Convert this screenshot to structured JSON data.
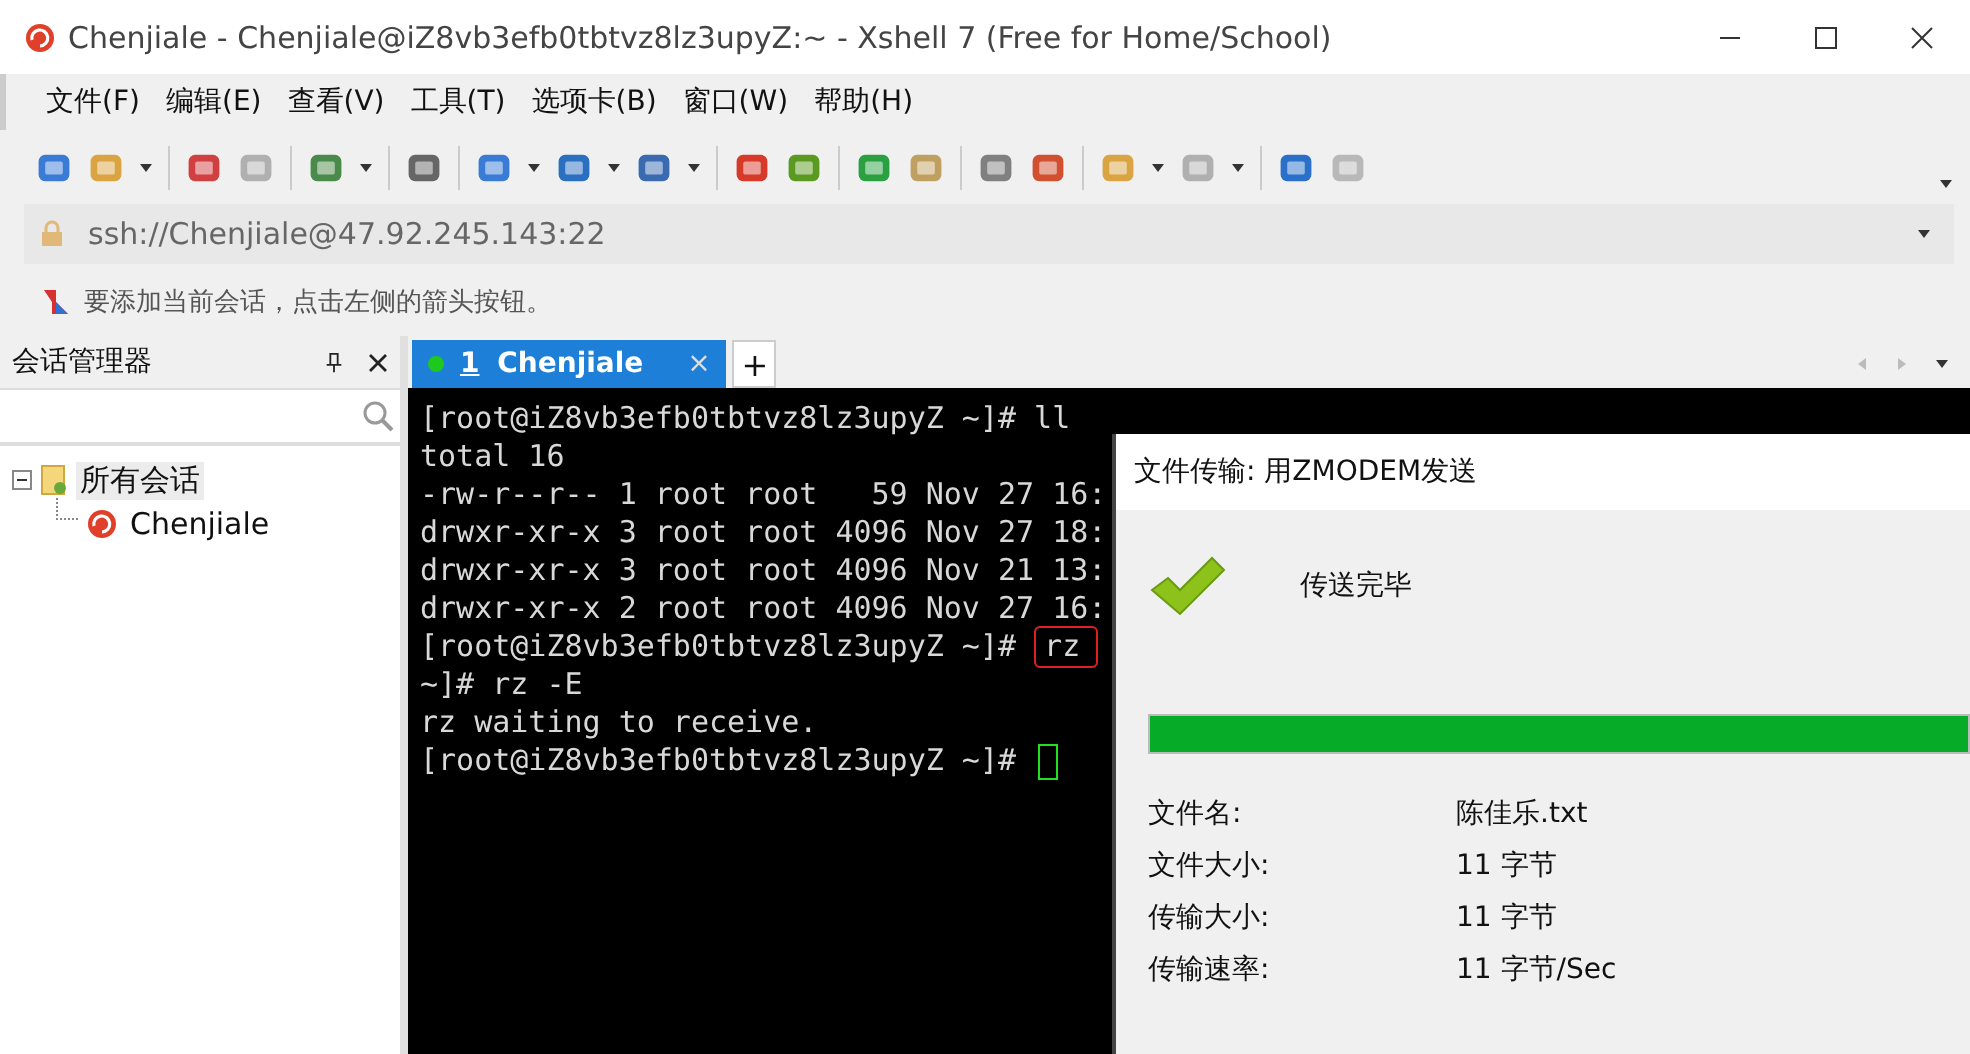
{
  "window": {
    "title": "Chenjiale - Chenjiale@iZ8vb3efb0tbtvz8lz3upyZ:~ - Xshell 7 (Free for Home/School)"
  },
  "menu": [
    "文件(F)",
    "编辑(E)",
    "查看(V)",
    "工具(T)",
    "选项卡(B)",
    "窗口(W)",
    "帮助(H)"
  ],
  "address": {
    "value": "ssh://Chenjiale@47.92.245.143:22"
  },
  "hint": "要添加当前会话，点击左侧的箭头按钮。",
  "session_manager": {
    "title": "会话管理器",
    "tree": [
      {
        "label": "所有会话",
        "expanded": true,
        "selected": true,
        "children": [
          {
            "label": "Chenjiale",
            "selected": false
          }
        ]
      }
    ]
  },
  "tabs": [
    {
      "number": "1",
      "label": "Chenjiale",
      "selected": true,
      "connected": true,
      "close": "×"
    }
  ],
  "new_tab": "+",
  "terminal": {
    "lines": [
      {
        "text": "[root@iZ8vb3efb0tbtvz8lz3upyZ ~]# ll"
      },
      {
        "text": "total 16"
      },
      {
        "text": "-rw-r--r-- 1 root root   59 Nov 27 16:"
      },
      {
        "text": "drwxr-xr-x 3 root root 4096 Nov 27 18:"
      },
      {
        "text": "drwxr-xr-x 3 root root 4096 Nov 21 13:"
      },
      {
        "text": "drwxr-xr-x 2 root root 4096 Nov 27 16:"
      },
      {
        "text": "[root@iZ8vb3efb0tbtvz8lz3upyZ ~]# ",
        "boxed": "rz"
      },
      {
        "text": "~]# rz -E"
      },
      {
        "text": "rz waiting to receive."
      },
      {
        "text": "[root@iZ8vb3efb0tbtvz8lz3upyZ ~]# ",
        "cursor": true
      }
    ]
  },
  "dialog": {
    "title": "文件传输: 用ZMODEM发送",
    "status": "传送完毕",
    "level": 1,
    "fields": [
      {
        "label": "文件名:",
        "value": "陈佳乐.txt"
      },
      {
        "label": "文件大小:",
        "value": "11 字节"
      },
      {
        "label": "传输大小:",
        "value": "11 字节"
      },
      {
        "label": "传输速率:",
        "value": "11 字节/Sec"
      }
    ]
  }
}
